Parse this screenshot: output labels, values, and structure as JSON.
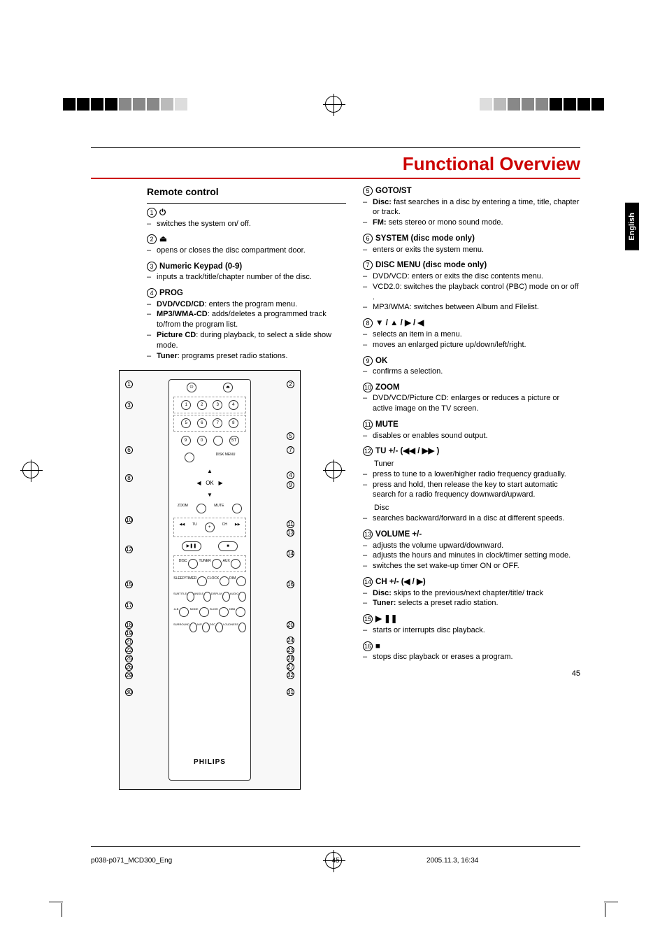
{
  "title": "Functional Overview",
  "lang_tab": "English",
  "page_number": "45",
  "left": {
    "heading": "Remote control",
    "items": [
      {
        "num": "1",
        "name": "⏻",
        "lines": [
          {
            "prefix": null,
            "text": "switches the system on/ off."
          }
        ]
      },
      {
        "num": "2",
        "name": "⏏",
        "lines": [
          {
            "prefix": null,
            "text": "opens or closes the disc compartment door."
          }
        ]
      },
      {
        "num": "3",
        "name": "Numeric Keypad (0-9)",
        "lines": [
          {
            "prefix": null,
            "text": "inputs a track/title/chapter number of the disc."
          }
        ]
      },
      {
        "num": "4",
        "name": "PROG",
        "lines": [
          {
            "prefix": "DVD/VCD/CD",
            "text": ": enters the program menu."
          },
          {
            "prefix": "MP3/WMA-CD",
            "text": ": adds/deletes a programmed track to/from the program list."
          },
          {
            "prefix": "Picture CD",
            "text": ": during playback, to select a slide show mode."
          },
          {
            "prefix": "Tuner",
            "text": ": programs preset radio stations."
          }
        ]
      }
    ],
    "remote_logo": "PHILIPS"
  },
  "right": {
    "items": [
      {
        "num": "5",
        "name": "GOTO/ST",
        "lines": [
          {
            "prefix": "Disc:",
            "text": " fast searches in a disc by entering a time, title, chapter or track."
          },
          {
            "prefix": "FM:",
            "text": " sets stereo or mono sound mode."
          }
        ]
      },
      {
        "num": "6",
        "name": "SYSTEM (disc mode only)",
        "lines": [
          {
            "prefix": null,
            "text": "enters or exits the system menu."
          }
        ]
      },
      {
        "num": "7",
        "name": "DISC MENU (disc mode only)",
        "lines": [
          {
            "prefix": null,
            "text": "DVD/VCD: enters or exits the disc contents menu."
          },
          {
            "prefix": null,
            "text": "VCD2.0: switches the playback control (PBC) mode on or off ."
          },
          {
            "prefix": null,
            "text": "MP3/WMA: switches between Album and Filelist."
          }
        ]
      },
      {
        "num": "8",
        "name": "▼ / ▲ / ▶ / ◀",
        "lines": [
          {
            "prefix": null,
            "text": "selects an item in a menu."
          },
          {
            "prefix": null,
            "text": "moves an enlarged picture up/down/left/right."
          }
        ]
      },
      {
        "num": "9",
        "name": "OK",
        "lines": [
          {
            "prefix": null,
            "text": "confirms a selection."
          }
        ]
      },
      {
        "num": "10",
        "name": "ZOOM",
        "lines": [
          {
            "prefix": null,
            "text": "DVD/VCD/Picture CD: enlarges or reduces a picture or active image on the TV screen."
          }
        ]
      },
      {
        "num": "11",
        "name": "MUTE",
        "lines": [
          {
            "prefix": null,
            "text": "disables or enables sound output."
          }
        ]
      },
      {
        "num": "12",
        "name": "TU +/- (◀◀ / ▶▶ )",
        "sub": "Tuner",
        "lines": [
          {
            "prefix": null,
            "text": "press to tune to a lower/higher radio frequency gradually."
          },
          {
            "prefix": null,
            "text": "press and hold, then release the key to start automatic search for a radio frequency downward/upward."
          }
        ],
        "sub2": "Disc",
        "lines2": [
          {
            "prefix": null,
            "text": "searches backward/forward in a disc at different speeds."
          }
        ]
      },
      {
        "num": "13",
        "name": "VOLUME +/-",
        "lines": [
          {
            "prefix": null,
            "text": "adjusts the volume upward/downward."
          },
          {
            "prefix": null,
            "text": "adjusts the hours and minutes in clock/timer setting mode."
          },
          {
            "prefix": null,
            "text": "switches the set wake-up timer ON or OFF."
          }
        ]
      },
      {
        "num": "14",
        "name": "CH +/- (◀ / ▶)",
        "lines": [
          {
            "prefix": "Disc:",
            "text": " skips to the previous/next chapter/title/ track"
          },
          {
            "prefix": "Tuner:",
            "text": " selects a preset radio station."
          }
        ]
      },
      {
        "num": "15",
        "name": "▶ ❚❚",
        "lines": [
          {
            "prefix": null,
            "text": "starts or interrupts disc playback."
          }
        ]
      },
      {
        "num": "16",
        "name": "■",
        "lines": [
          {
            "prefix": null,
            "text": "stops disc playback or erases a program."
          }
        ]
      }
    ]
  },
  "footer": {
    "file": "p038-p071_MCD300_Eng",
    "page": "45",
    "date": "2005.11.3, 16:34"
  }
}
